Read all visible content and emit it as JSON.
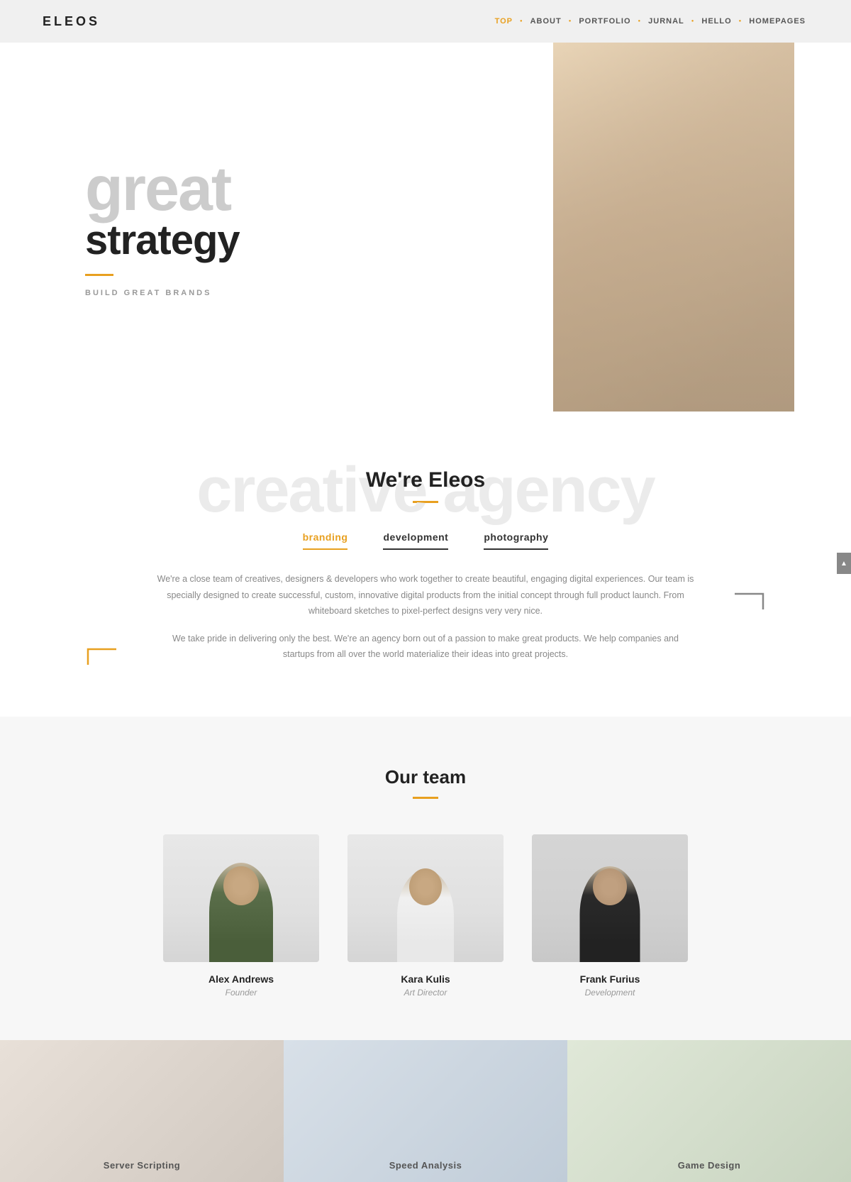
{
  "header": {
    "logo": "ELEOS",
    "nav": [
      {
        "label": "TOP",
        "active": true
      },
      {
        "label": "ABOUT",
        "active": false
      },
      {
        "label": "PORTFOLIO",
        "active": false
      },
      {
        "label": "JURNAL",
        "active": false
      },
      {
        "label": "HELLO",
        "active": false
      },
      {
        "label": "HOMEPAGES",
        "active": false
      }
    ]
  },
  "hero": {
    "word1": "great",
    "word2": "strategy",
    "tagline": "BUILD GREAT BRANDS"
  },
  "we_are": {
    "bg_text": "creative agency",
    "title": "We're Eleos",
    "tabs": [
      {
        "label": "branding",
        "style": "active"
      },
      {
        "label": "development",
        "style": "dark"
      },
      {
        "label": "photography",
        "style": "dark2"
      }
    ],
    "body1": "We're a close team of creatives, designers & developers who work together to create beautiful, engaging digital experiences. Our team is specially designed to create successful, custom, innovative digital products from the initial concept through full product launch. From whiteboard sketches to pixel-perfect designs very very nice.",
    "body2": "We take pride in delivering only the best. We're an agency born out of a passion to make great products. We help companies and startups from all over the world materialize their ideas into great projects."
  },
  "team": {
    "title": "Our team",
    "members": [
      {
        "name": "Alex Andrews",
        "role": "Founder"
      },
      {
        "name": "Kara Kulis",
        "role": "Art Director"
      },
      {
        "name": "Frank Furius",
        "role": "Development"
      }
    ]
  },
  "bottom": {
    "tiles": [
      {
        "label": "Server Scripting"
      },
      {
        "label": "Speed Analysis"
      },
      {
        "label": "Game Design"
      }
    ]
  },
  "scroll_btn": "▲"
}
